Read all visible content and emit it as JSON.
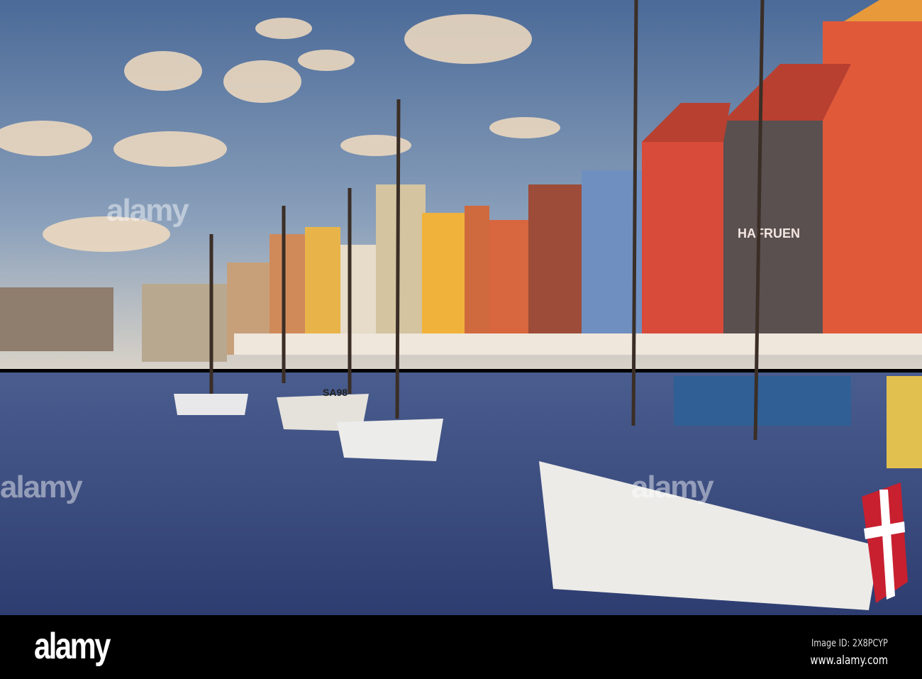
{
  "scene": {
    "subject": "harbour",
    "sign_text": "HAFRUEN",
    "boat_registration": "SA98",
    "colors": {
      "sky_top": "#4f6f9a",
      "sky_bottom": "#c9cfd6",
      "water": "#3c4f86",
      "footer": "#000000"
    }
  },
  "watermark": {
    "text": "alamy"
  },
  "footer": {
    "logo": "alamy",
    "image_id": "Image ID: 2X8PCYP",
    "url": "www.alamy.com"
  }
}
